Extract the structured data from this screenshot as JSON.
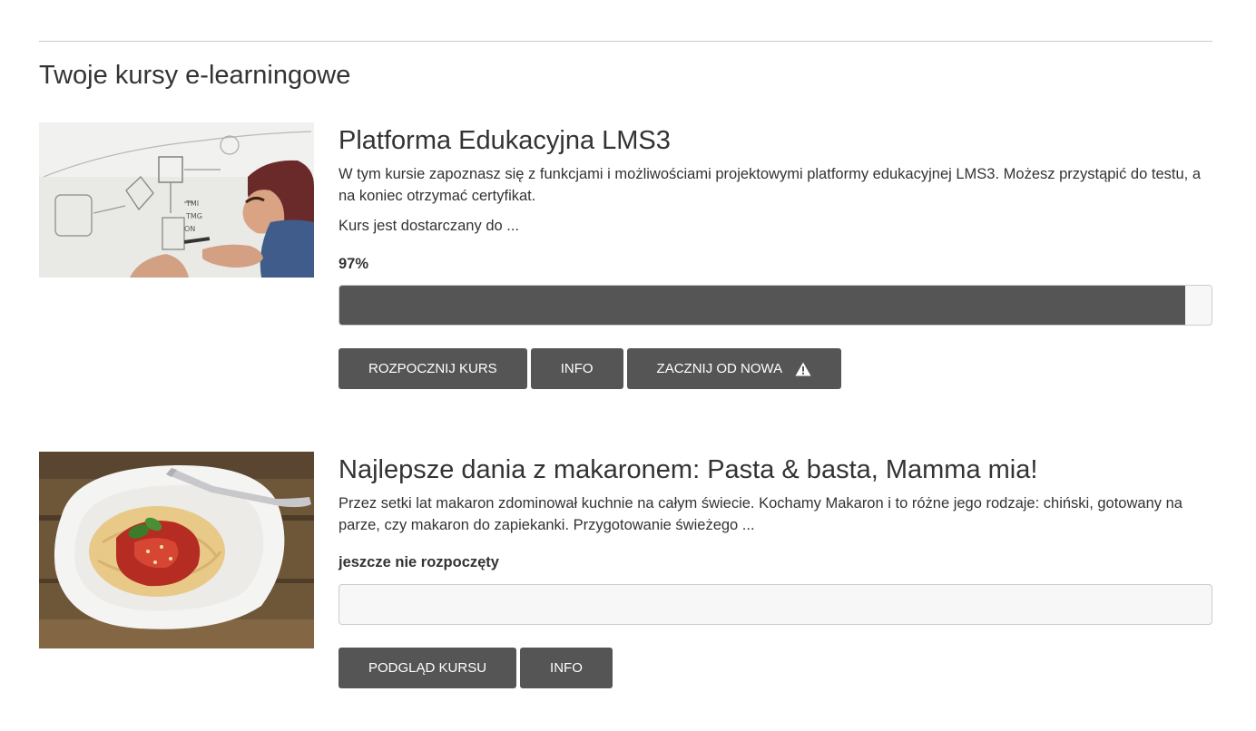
{
  "section_title": "Twoje kursy e-learningowe",
  "colors": {
    "button_bg": "#555555",
    "button_text": "#ffffff",
    "progress_fill": "#555555",
    "progress_track": "#f7f7f7"
  },
  "courses": [
    {
      "title": "Platforma Edukacyjna LMS3",
      "description": "W tym kursie zapoznasz się z funkcjami i możliwościami projektowymi platformy edukacyjnej LMS3. Możesz przystąpić do testu, a na koniec otrzymać certyfikat.",
      "extra": "Kurs jest dostarczany do ...",
      "status": "97%",
      "progress": 0.97,
      "buttons": {
        "start": "ROZPOCZNIJ KURS",
        "info": "INFO",
        "restart": "ZACZNIJ OD NOWA"
      },
      "restart_icon": "warning-icon"
    },
    {
      "title": "Najlepsze dania z makaronem: Pasta & basta, Mamma mia!",
      "description": "Przez setki lat makaron zdominował kuchnie na całym świecie. Kochamy Makaron i to różne jego rodzaje: chiński, gotowany na parze, czy makaron do zapiekanki. Przygotowanie świeżego ...",
      "status": "jeszcze nie rozpoczęty",
      "progress": 0,
      "buttons": {
        "preview": "PODGLĄD KURSU",
        "info": "INFO"
      }
    }
  ]
}
